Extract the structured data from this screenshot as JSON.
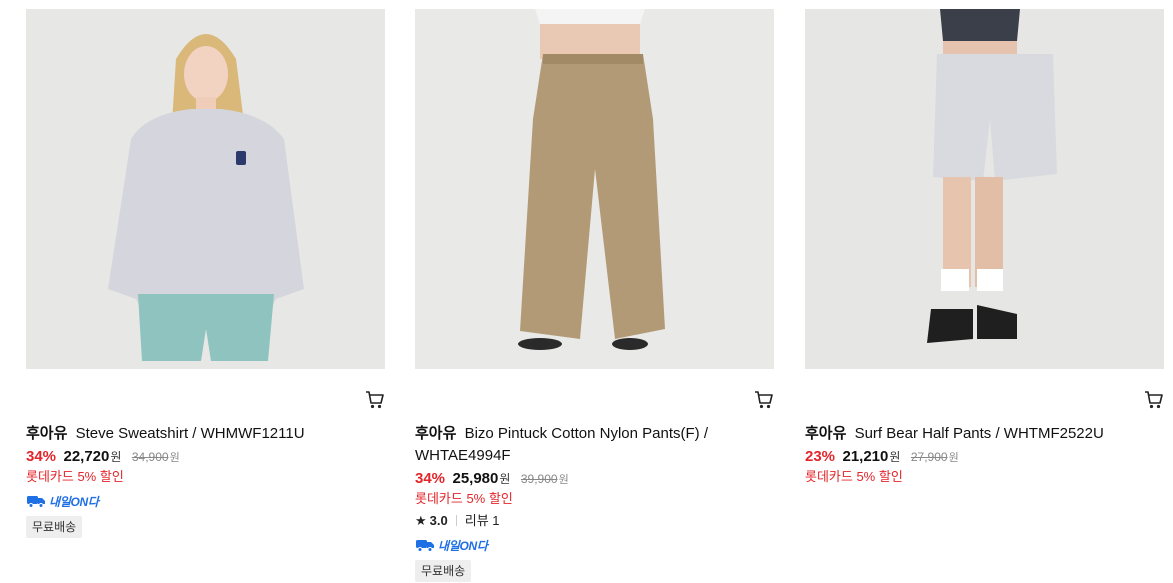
{
  "products": [
    {
      "brand": "후아유",
      "name": "Steve Sweatshirt / WHMWF1211U",
      "discount": "34%",
      "price": "22,720",
      "price_unit": "원",
      "original_price": "34,900",
      "original_unit": "원",
      "promo": "롯데카드 5% 할인",
      "delivery_badge": "내일ON다",
      "shipping_badge": "무료배송"
    },
    {
      "brand": "후아유",
      "name": "Bizo Pintuck Cotton Nylon Pants(F) / WHTAE4994F",
      "discount": "34%",
      "price": "25,980",
      "price_unit": "원",
      "original_price": "39,900",
      "original_unit": "원",
      "promo": "롯데카드 5% 할인",
      "rating": "3.0",
      "review_label": "리뷰 1",
      "delivery_badge": "내일ON다",
      "shipping_badge": "무료배송"
    },
    {
      "brand": "후아유",
      "name": "Surf Bear Half Pants / WHTMF2522U",
      "discount": "23%",
      "price": "21,210",
      "price_unit": "원",
      "original_price": "27,900",
      "original_unit": "원",
      "promo": "롯데카드 5% 할인"
    }
  ],
  "icons": {
    "cart": "cart-icon",
    "star": "star-icon",
    "delivery": "truck-icon"
  },
  "colors": {
    "discount": "#e4252a",
    "delivery_badge": "#1f6fe5",
    "shipping_badge_bg": "#eeeeee",
    "thumb_bg": "#e8e8e6"
  }
}
